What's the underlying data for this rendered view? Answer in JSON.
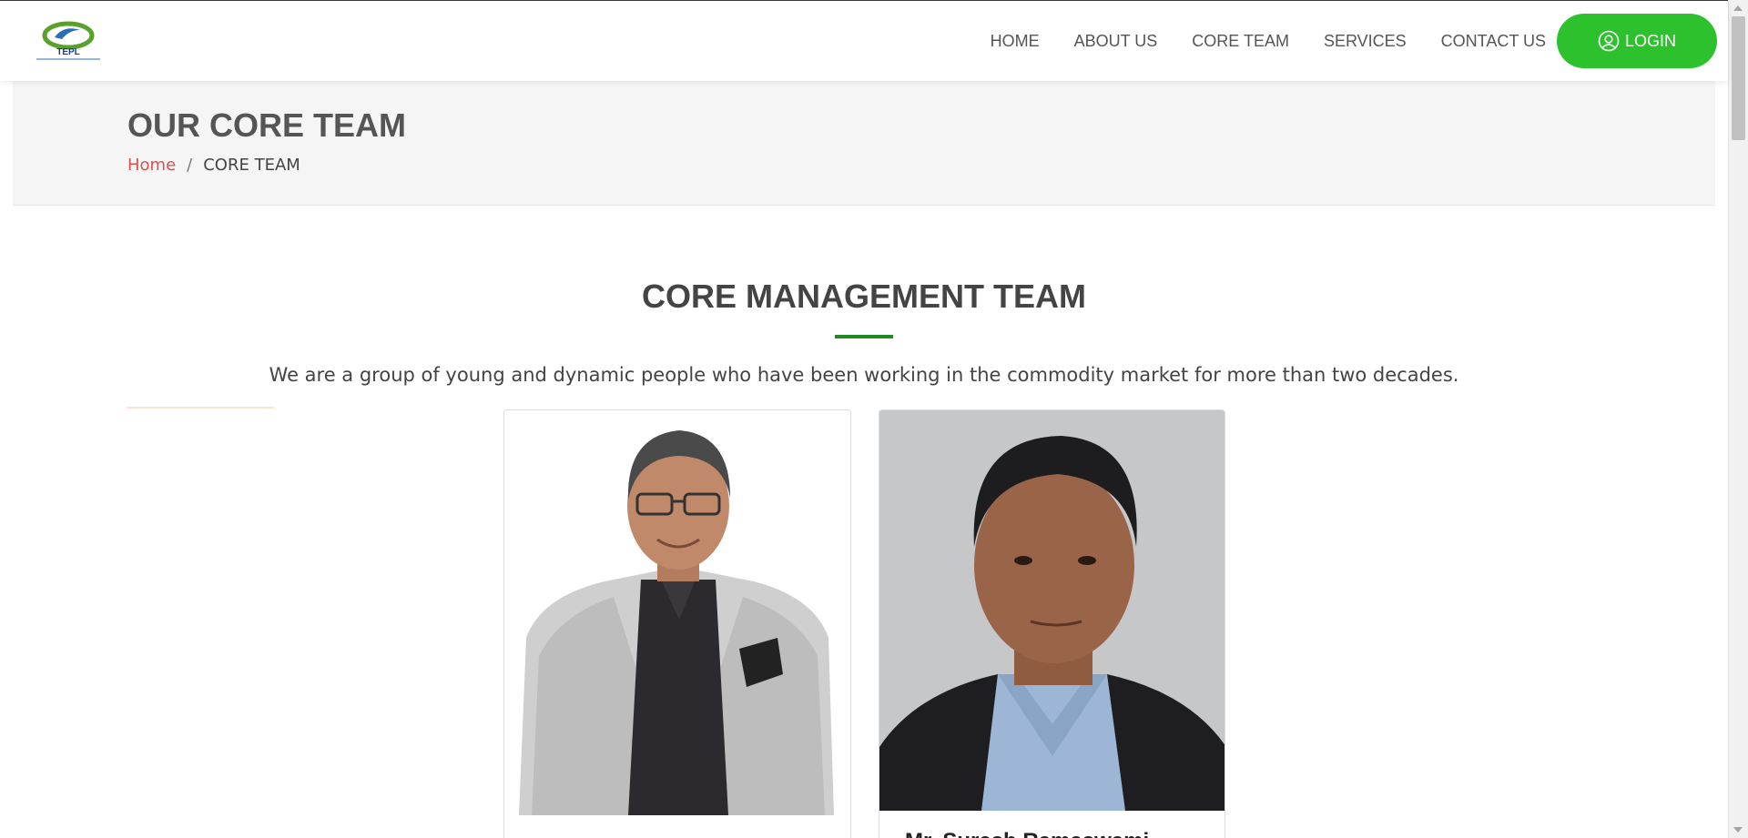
{
  "brand": {
    "logo_text": "TEPL",
    "colors": {
      "accent": "#2dc22d",
      "underline": "#1f8a1f",
      "crumb_link": "#d9534f"
    }
  },
  "nav": {
    "items": [
      {
        "label": "HOME"
      },
      {
        "label": "ABOUT US"
      },
      {
        "label": "CORE TEAM"
      },
      {
        "label": "SERVICES"
      },
      {
        "label": "CONTACT US"
      }
    ],
    "login_label": "LOGIN",
    "login_icon": "user-circle-icon"
  },
  "banner": {
    "title": "OUR CORE TEAM",
    "breadcrumb": {
      "home": "Home",
      "separator": "/",
      "current": "CORE TEAM"
    }
  },
  "section": {
    "title": "CORE MANAGEMENT TEAM",
    "description": "We are a group of young and dynamic people who have been working in the commodity market for more than two decades."
  },
  "team": [
    {
      "name": "",
      "photo": "portrait-man-grey-blazer"
    },
    {
      "name": "Mr. Suresh Ramaswami",
      "photo": "portrait-man-dark-suit"
    }
  ]
}
